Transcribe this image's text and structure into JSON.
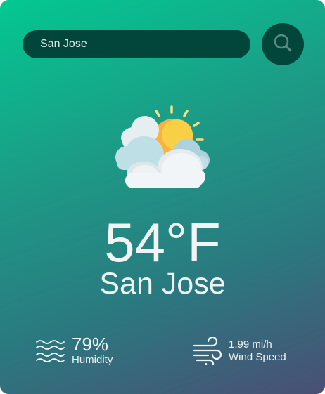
{
  "search": {
    "value": "San Jose",
    "button_icon": "search-icon"
  },
  "weather": {
    "icon": "partly-cloudy-icon",
    "temperature": "54°F",
    "city": "San Jose"
  },
  "details": {
    "humidity": {
      "icon": "humidity-waves-icon",
      "value": "79%",
      "label": "Humidity"
    },
    "wind": {
      "icon": "wind-icon",
      "value": "1.99 mi/h",
      "label": "Wind Speed"
    }
  },
  "colors": {
    "gradient_start": "#03c891",
    "gradient_end": "#4a4f74",
    "control_bg": "#02463b",
    "sun": "#fbbf24"
  }
}
